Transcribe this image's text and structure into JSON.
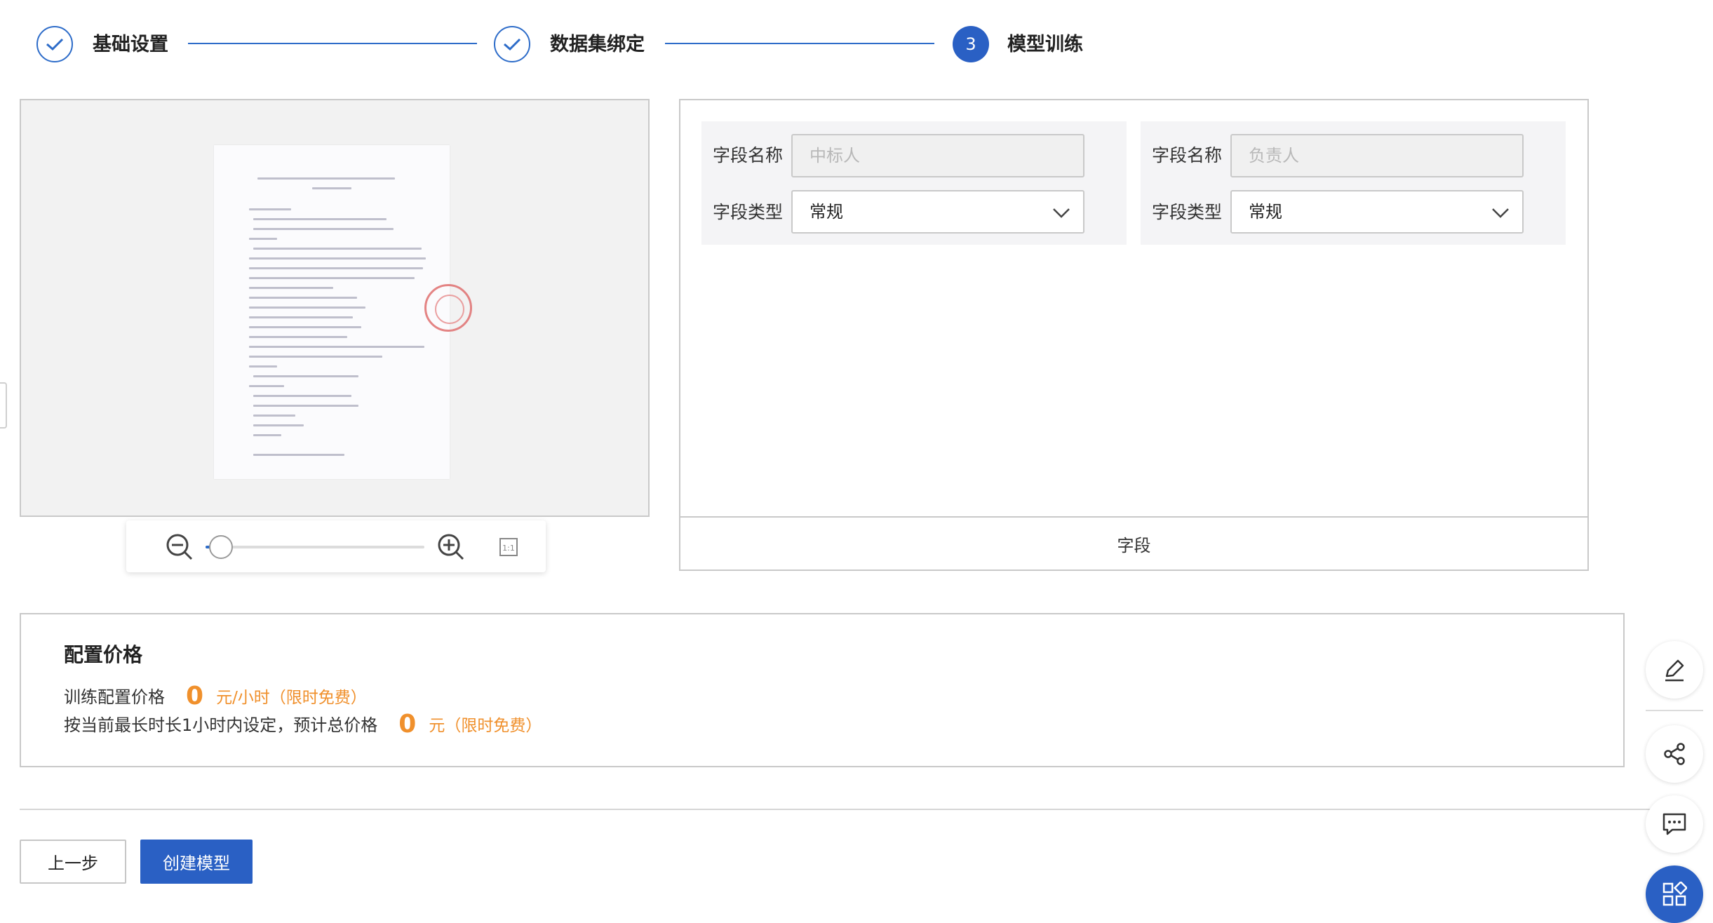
{
  "steps": [
    {
      "label": "基础设置",
      "status": "done"
    },
    {
      "label": "数据集绑定",
      "status": "done"
    },
    {
      "label": "模型训练",
      "status": "active",
      "number": "3"
    }
  ],
  "preview": {
    "zoom_level": 0.07,
    "fit_label": "1:1"
  },
  "fields": {
    "cards": [
      {
        "name_label": "字段名称",
        "name_placeholder": "中标人",
        "type_label": "字段类型",
        "type_value": "常规"
      },
      {
        "name_label": "字段名称",
        "name_placeholder": "负责人",
        "type_label": "字段类型",
        "type_value": "常规"
      }
    ],
    "footer": "字段"
  },
  "price": {
    "title": "配置价格",
    "rows": [
      {
        "label": "训练配置价格",
        "value": "0",
        "unit": "元/小时（限时免费）"
      },
      {
        "label": "按当前最长时长1小时内设定，预计总价格",
        "value": "0",
        "unit": "元（限时免费）"
      }
    ]
  },
  "buttons": {
    "prev": "上一步",
    "create": "创建模型"
  },
  "floating_tools": [
    "edit-icon",
    "share-icon",
    "comment-icon",
    "apps-icon"
  ],
  "colors": {
    "primary": "#2a60c4",
    "price_accent": "#f0902c"
  }
}
